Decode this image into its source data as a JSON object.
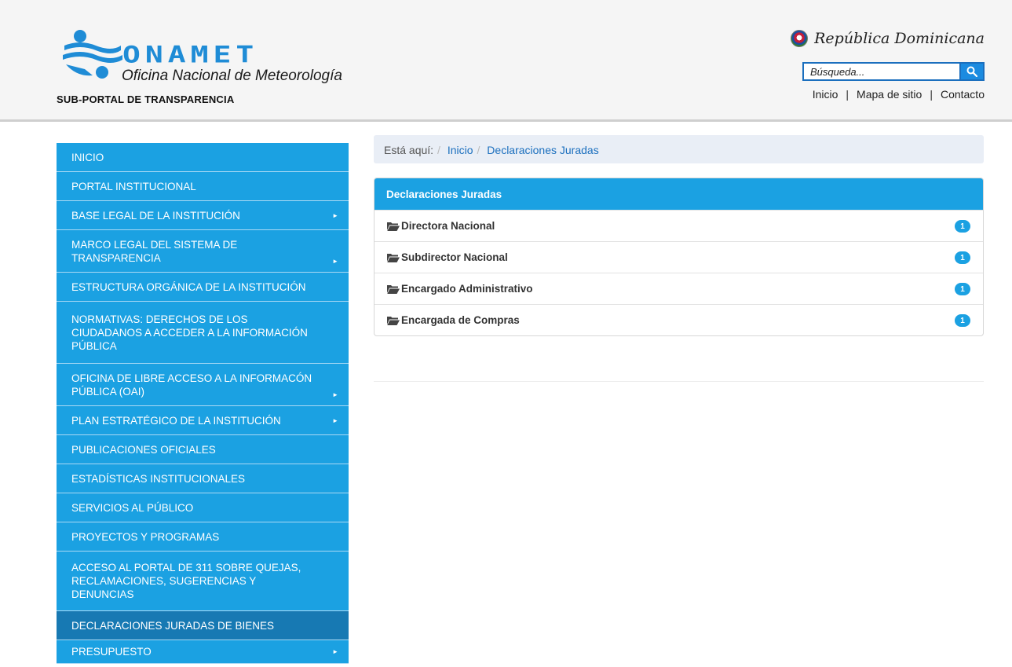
{
  "header": {
    "logo_word": "ONAMET",
    "logo_subtitle": "Oficina Nacional de Meteorología",
    "subportal": "SUB-PORTAL DE TRANSPARENCIA",
    "country": "República Dominicana",
    "search": {
      "placeholder": "Búsqueda..."
    },
    "links": [
      "Inicio",
      "Mapa de sitio",
      "Contacto"
    ]
  },
  "sidebar": {
    "items": [
      {
        "label": "INICIO",
        "arrow": false
      },
      {
        "label": "PORTAL INSTITUCIONAL",
        "arrow": false
      },
      {
        "label": "BASE LEGAL DE LA INSTITUCIÓN",
        "arrow": true
      },
      {
        "label": "MARCO LEGAL DEL SISTEMA DE TRANSPARENCIA",
        "arrow": true
      },
      {
        "label": "ESTRUCTURA ORGÁNICA DE LA INSTITUCIÓN",
        "arrow": false
      },
      {
        "label": "NORMATIVAS: DERECHOS DE LOS CIUDADANOS A ACCEDER A LA INFORMACIÓN PÚBLICA",
        "arrow": false
      },
      {
        "label": "OFICINA DE LIBRE ACCESO A LA INFORMACÓN PÚBLICA (OAI)",
        "arrow": true
      },
      {
        "label": "PLAN ESTRATÉGICO DE LA INSTITUCIÓN",
        "arrow": true
      },
      {
        "label": "PUBLICACIONES OFICIALES",
        "arrow": false
      },
      {
        "label": "ESTADÍSTICAS INSTITUCIONALES",
        "arrow": false
      },
      {
        "label": "SERVICIOS AL PÚBLICO",
        "arrow": false
      },
      {
        "label": "PROYECTOS Y PROGRAMAS",
        "arrow": false
      },
      {
        "label": "ACCESO AL PORTAL DE 311 SOBRE QUEJAS, RECLAMACIONES, SUGERENCIAS Y DENUNCIAS",
        "arrow": false
      },
      {
        "label": "DECLARACIONES JURADAS DE BIENES",
        "arrow": false,
        "active": true
      },
      {
        "label": "PRESUPUESTO",
        "arrow": true
      }
    ]
  },
  "breadcrumb": {
    "prefix": "Está aquí:",
    "items": [
      "Inicio",
      "Declaraciones Juradas"
    ]
  },
  "panel": {
    "title": "Declaraciones Juradas",
    "rows": [
      {
        "label": "Directora Nacional",
        "count": "1"
      },
      {
        "label": "Subdirector Nacional",
        "count": "1"
      },
      {
        "label": "Encargado Administrativo",
        "count": "1"
      },
      {
        "label": "Encargada de Compras",
        "count": "1"
      }
    ]
  },
  "colors": {
    "accent": "#1ba1e2",
    "active": "#1779b3",
    "link": "#1b6fbe"
  }
}
